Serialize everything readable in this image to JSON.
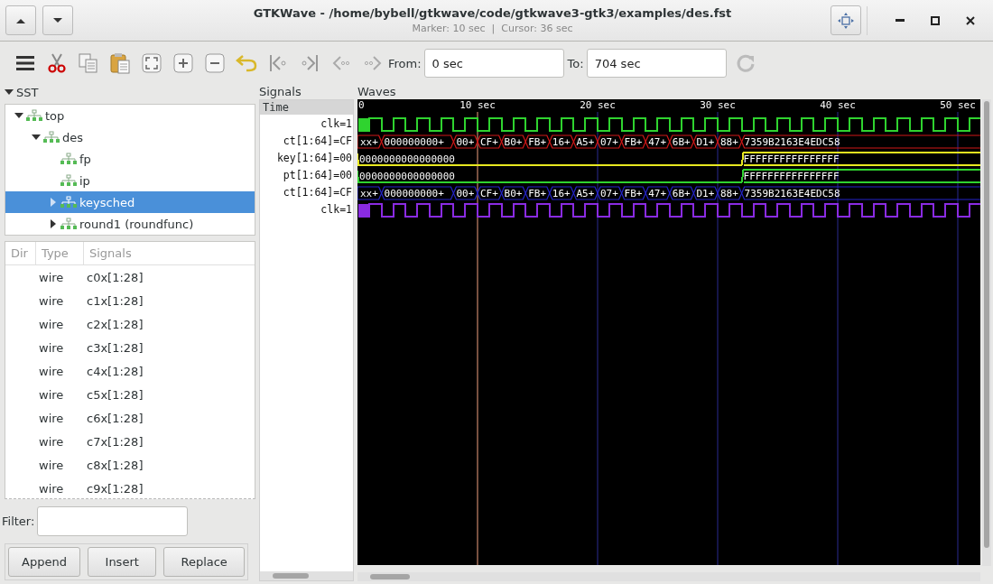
{
  "window": {
    "title": "GTKWave - /home/bybell/gtkwave/code/gtkwave3-gtk3/examples/des.fst",
    "subtitle": "Marker: 10 sec  |  Cursor: 36 sec"
  },
  "toolbar": {
    "from_label": "From:",
    "from_value": "0 sec",
    "to_label": "To:",
    "to_value": "704 sec"
  },
  "sst": {
    "title": "SST",
    "expanded": true,
    "tree": [
      {
        "label": "top",
        "expanded": true,
        "selected": false,
        "children": [
          {
            "label": "des",
            "expanded": true,
            "selected": false,
            "children": [
              {
                "label": "fp",
                "selected": false
              },
              {
                "label": "ip",
                "selected": false
              },
              {
                "label": "keysched",
                "expanded": false,
                "selected": true
              },
              {
                "label": "round1  (roundfunc)",
                "expanded": false,
                "selected": false
              }
            ]
          }
        ]
      }
    ]
  },
  "signal_list": {
    "columns": [
      "Dir",
      "Type",
      "Signals"
    ],
    "rows": [
      {
        "type": "wire",
        "signal": "c0x[1:28]"
      },
      {
        "type": "wire",
        "signal": "c1x[1:28]"
      },
      {
        "type": "wire",
        "signal": "c2x[1:28]"
      },
      {
        "type": "wire",
        "signal": "c3x[1:28]"
      },
      {
        "type": "wire",
        "signal": "c4x[1:28]"
      },
      {
        "type": "wire",
        "signal": "c5x[1:28]"
      },
      {
        "type": "wire",
        "signal": "c6x[1:28]"
      },
      {
        "type": "wire",
        "signal": "c7x[1:28]"
      },
      {
        "type": "wire",
        "signal": "c8x[1:28]"
      },
      {
        "type": "wire",
        "signal": "c9x[1:28]"
      }
    ]
  },
  "filter": {
    "label": "Filter:"
  },
  "buttons": [
    "Append",
    "Insert",
    "Replace"
  ],
  "signals_pane": {
    "title": "Signals",
    "header": "Time",
    "rows": [
      {
        "name": "clk",
        "value": "=1"
      },
      {
        "name": "ct[1:64]",
        "value": "=CF"
      },
      {
        "name": "key[1:64]",
        "value": "=00"
      },
      {
        "name": "pt[1:64]",
        "value": "=00"
      },
      {
        "name": "ct[1:64]",
        "value": "=CF"
      },
      {
        "name": "clk",
        "value": "=1"
      }
    ]
  },
  "waves": {
    "title": "Waves",
    "ruler": [
      "0",
      "10 sec",
      "20 sec",
      "30 sec",
      "40 sec",
      "50 sec"
    ],
    "traces": [
      {
        "kind": "clock",
        "color": "#2fd32f"
      },
      {
        "kind": "bus",
        "color": "#d01818",
        "values": [
          "xx+",
          "000000000+",
          "00+",
          "CF+",
          "B0+",
          "FB+",
          "16+",
          "A5+",
          "07+",
          "FB+",
          "47+",
          "6B+",
          "D1+",
          "88+",
          "7359B2163E4EDC58"
        ]
      },
      {
        "kind": "level-bus",
        "color": "#e8e820",
        "values": [
          "0000000000000000",
          "FFFFFFFFFFFFFFFF"
        ]
      },
      {
        "kind": "level-bus",
        "color": "#2fd32f",
        "values": [
          "0000000000000000",
          "FFFFFFFFFFFFFFFF"
        ]
      },
      {
        "kind": "bus",
        "color": "#2424c8",
        "values": [
          "xx+",
          "000000000+",
          "00+",
          "CF+",
          "B0+",
          "FB+",
          "16+",
          "A5+",
          "07+",
          "FB+",
          "47+",
          "6B+",
          "D1+",
          "88+",
          "7359B2163E4EDC58"
        ]
      },
      {
        "kind": "clock",
        "color": "#8a2be2"
      }
    ]
  }
}
